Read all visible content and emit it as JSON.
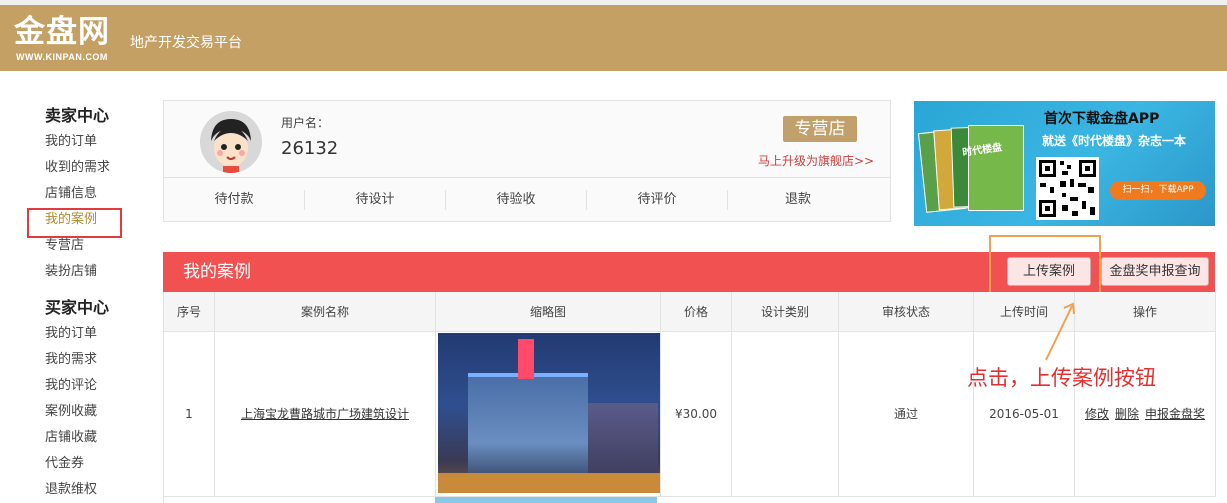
{
  "header": {
    "logo_text": "金盘网",
    "logo_url_text": "WWW.KINPAN.COM",
    "tagline": "地产开发交易平台"
  },
  "sidebar": {
    "seller_title": "卖家中心",
    "seller_items": [
      "我的订单",
      "收到的需求",
      "店铺信息",
      "我的案例",
      "专营店",
      "装扮店铺"
    ],
    "buyer_title": "买家中心",
    "buyer_items": [
      "我的订单",
      "我的需求",
      "我的评论",
      "案例收藏",
      "店铺收藏",
      "代金券",
      "退款维权"
    ],
    "active_item": "我的案例"
  },
  "profile": {
    "username_label": "用户名：",
    "username": "26132",
    "store_badge": "专营店",
    "upgrade_link": "马上升级为旗舰店>>",
    "status_tabs": [
      "待付款",
      "待设计",
      "待验收",
      "待评价",
      "退款"
    ]
  },
  "banner": {
    "title": "首次下载金盘APP",
    "subtitle": "就送《时代楼盘》杂志一本",
    "book_text": "时代楼盘",
    "scan_label": "扫一扫，下载APP"
  },
  "section": {
    "title": "我的案例",
    "upload_button": "上传案例",
    "query_button": "金盘奖申报查询"
  },
  "table": {
    "headers": [
      "序号",
      "案例名称",
      "缩略图",
      "价格",
      "设计类别",
      "审核状态",
      "上传时间",
      "操作"
    ],
    "rows": [
      {
        "index": "1",
        "name": "上海宝龙曹路城市广场建筑设计",
        "price": "¥30.00",
        "category": "",
        "status": "通过",
        "upload_time": "2016-05-01",
        "actions": [
          "修改",
          "删除",
          "申报金盘奖"
        ]
      }
    ]
  },
  "annotation": {
    "text": "点击，上传案例按钮"
  },
  "colors": {
    "header_gold": "#c4a064",
    "section_red": "#f15150",
    "annotation_red": "#e32f2f",
    "highlight_orange": "#f0a050"
  }
}
